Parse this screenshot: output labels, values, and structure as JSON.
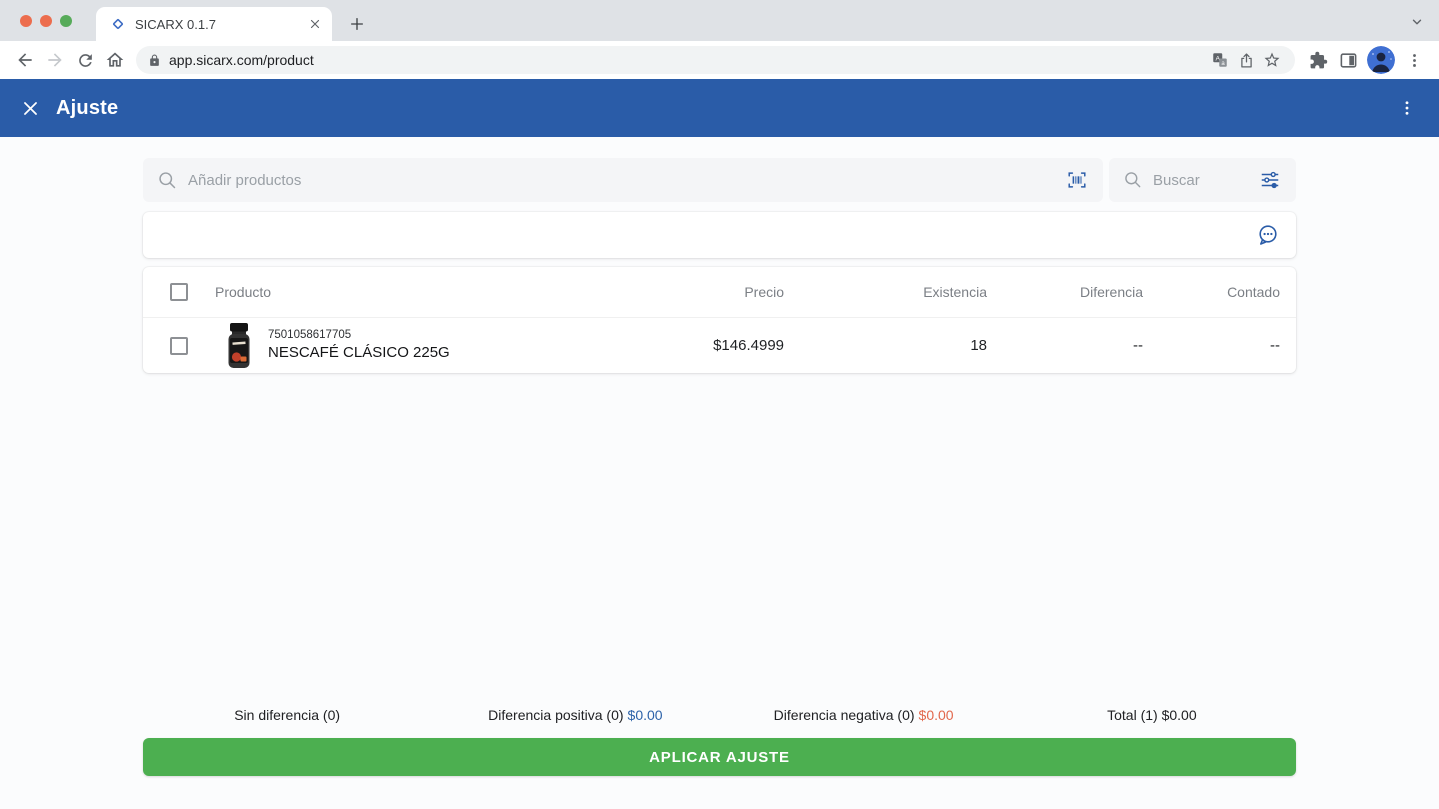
{
  "browser": {
    "tab_title": "SICARX 0.1.7",
    "url": "app.sicarx.com/product"
  },
  "app_header": {
    "title": "Ajuste"
  },
  "search": {
    "add_products_placeholder": "Añadir productos",
    "search_placeholder": "Buscar"
  },
  "table": {
    "headers": {
      "product": "Producto",
      "price": "Precio",
      "stock": "Existencia",
      "difference": "Diferencia",
      "counted": "Contado"
    },
    "rows": [
      {
        "barcode": "7501058617705",
        "name": "NESCAFÉ CLÁSICO 225G",
        "price": "$146.4999",
        "stock": "18",
        "difference": "--",
        "counted": "--"
      }
    ]
  },
  "summary": {
    "no_difference": "Sin diferencia (0)",
    "positive_label": "Diferencia positiva (0)",
    "positive_value": "$0.00",
    "negative_label": "Diferencia negativa (0)",
    "negative_value": "$0.00",
    "total": "Total (1) $0.00"
  },
  "actions": {
    "apply": "APLICAR AJUSTE"
  },
  "colors": {
    "header_blue": "#2a5ca8",
    "accent_blue": "#2a5ca8",
    "positive_blue": "#2c62a9",
    "negative_red": "#e2674c",
    "button_green": "#4caf50"
  }
}
